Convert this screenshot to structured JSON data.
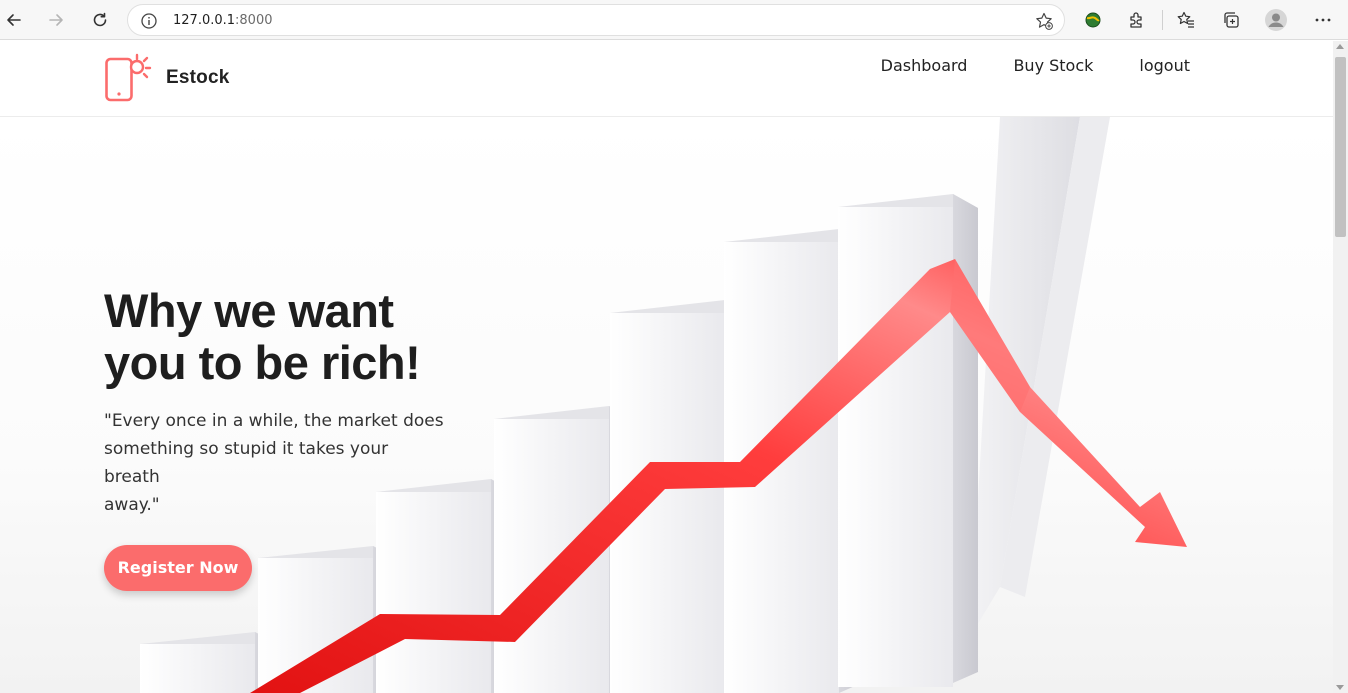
{
  "browser": {
    "url_host": "127.0.0.1",
    "url_port": ":8000",
    "icons": [
      "back-icon",
      "forward-icon",
      "reload-icon",
      "site-info-icon",
      "add-favorite-icon",
      "extension-globe-icon",
      "extensions-icon",
      "favorites-icon",
      "collections-icon",
      "profile-icon",
      "more-icon"
    ]
  },
  "site": {
    "brand": "Estock",
    "accent_color": "#fb6c6c",
    "nav": {
      "dashboard": "Dashboard",
      "buy_stock": "Buy Stock",
      "logout": "logout"
    }
  },
  "hero": {
    "title_line1": "Why we want",
    "title_line2": "you to be rich!",
    "quote_line1": "\"Every once in a while, the market does",
    "quote_line2": "something so stupid it takes your breath",
    "quote_line3": "away.\"",
    "cta_label": "Register Now"
  }
}
